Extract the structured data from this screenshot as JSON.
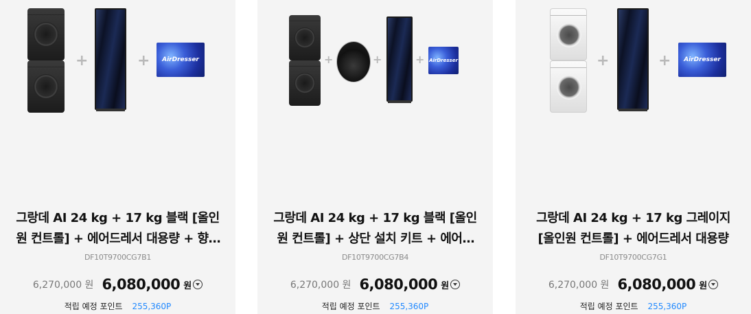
{
  "products": [
    {
      "title": "그랑데 AI 24 kg + 17 kg 블랙 [올인원 컨트롤] + 에어드레서 대용량 + 향기 시트",
      "model": "DF10T9700CG7B1",
      "original_price": "6,270,000 원",
      "final_price": "6,080,000",
      "currency": "원",
      "points_label": "적립 예정 포인트",
      "points_value": "255,360P",
      "images": [
        "washer-dryer-stack-black",
        "airdresser-black",
        "fragrance-sheet-box"
      ],
      "sheet_label": "AirDresser"
    },
    {
      "title": "그랑데 AI 24 kg + 17 kg 블랙 [올인원 컨트롤] + 상단 설치 키트 + 에어드레서",
      "model": "DF10T9700CG7B4",
      "original_price": "6,270,000 원",
      "final_price": "6,080,000",
      "currency": "원",
      "points_label": "적립 예정 포인트",
      "points_value": "255,360P",
      "images": [
        "washer-dryer-stack-black",
        "top-install-kit",
        "airdresser-black",
        "fragrance-sheet-box"
      ],
      "sheet_label": "AirDresser"
    },
    {
      "title": "그랑데 AI 24 kg + 17 kg 그레이지 [올인원 컨트롤] + 에어드레서 대용량",
      "model": "DF10T9700CG7G1",
      "original_price": "6,270,000 원",
      "final_price": "6,080,000",
      "currency": "원",
      "points_label": "적립 예정 포인트",
      "points_value": "255,360P",
      "images": [
        "washer-dryer-stack-greige",
        "airdresser-black",
        "fragrance-sheet-box"
      ],
      "sheet_label": "AirDresser"
    }
  ],
  "plus_symbol": "+"
}
